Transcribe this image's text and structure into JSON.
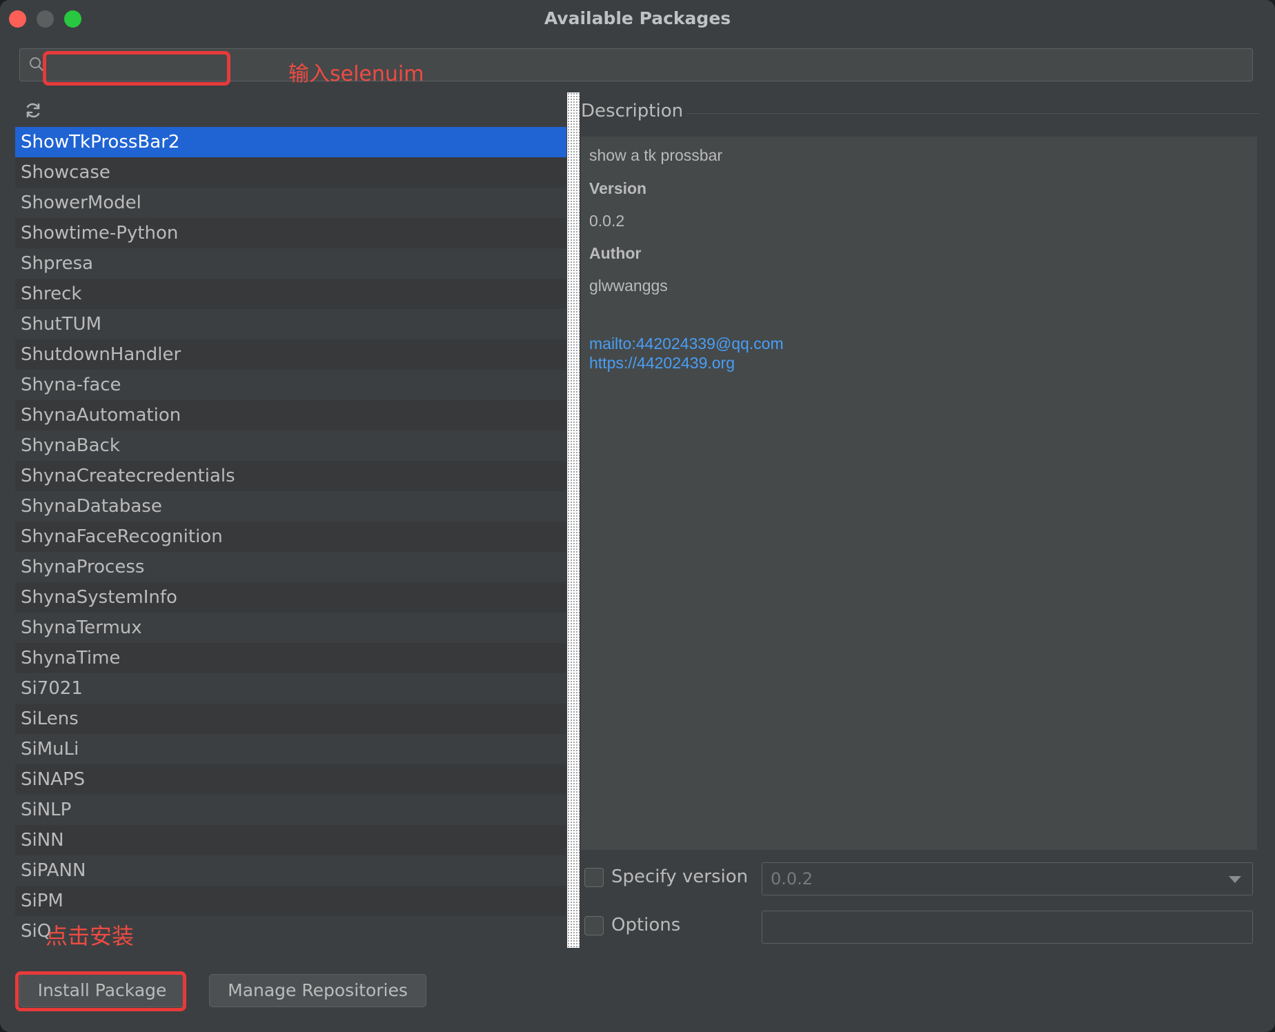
{
  "window": {
    "title": "Available Packages"
  },
  "search": {
    "value": "",
    "placeholder": ""
  },
  "annotations": {
    "search_hint": "输入selenuim",
    "install_hint": "点击安装"
  },
  "packages": [
    "ShowTkProssBar2",
    "Showcase",
    "ShowerModel",
    "Showtime-Python",
    "Shpresa",
    "Shreck",
    "ShutTUM",
    "ShutdownHandler",
    "Shyna-face",
    "ShynaAutomation",
    "ShynaBack",
    "ShynaCreatecredentials",
    "ShynaDatabase",
    "ShynaFaceRecognition",
    "ShynaProcess",
    "ShynaSystemInfo",
    "ShynaTermux",
    "ShynaTime",
    "Si7021",
    "SiLens",
    "SiMuLi",
    "SiNAPS",
    "SiNLP",
    "SiNN",
    "SiPANN",
    "SiPM",
    "SiQ"
  ],
  "selected_index": 0,
  "description": {
    "header": "Description",
    "summary": "show a tk prossbar",
    "version_label": "Version",
    "version": "0.0.2",
    "author_label": "Author",
    "author": "glwwanggs",
    "links": [
      "mailto:442024339@qq.com",
      "https://44202439.org"
    ]
  },
  "options": {
    "specify_version_label": "Specify version",
    "specify_version_checked": false,
    "version_select_value": "0.0.2",
    "options_label": "Options",
    "options_checked": false,
    "options_value": ""
  },
  "buttons": {
    "install": "Install Package",
    "manage": "Manage Repositories"
  },
  "colors": {
    "selection": "#2064d4",
    "link": "#4a9ef5",
    "annotation": "#e83a3a"
  },
  "icons": [
    "search-icon",
    "refresh-icon",
    "chevron-down-icon"
  ]
}
